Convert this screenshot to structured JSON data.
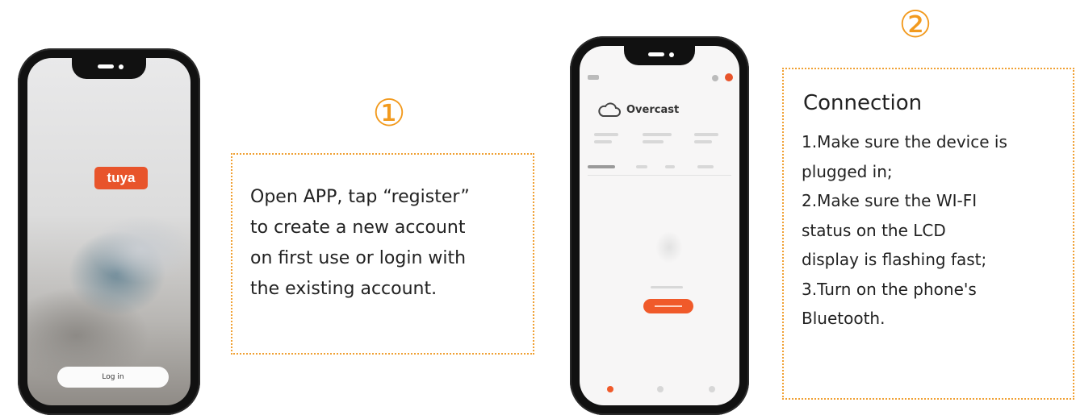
{
  "step1": {
    "number": "①",
    "logo_text": "tuya",
    "login_label": "Log in",
    "text_lines": [
      "Open APP, tap   “register”",
      "to create a new account",
      "on first use or login with",
      "the existing account."
    ]
  },
  "step2": {
    "number": "②",
    "weather_label": "Overcast",
    "title": "Connection",
    "text_lines": [
      "1.Make sure the device is",
      "plugged in;",
      "2.Make sure the WI-FI",
      "status on the LCD",
      "display is flashing fast;",
      "3.Turn on the phone's",
      "Bluetooth."
    ]
  },
  "colors": {
    "accent_orange": "#f29a1e",
    "brand_orange": "#e8542b",
    "dotted_border": "#f0a033"
  }
}
